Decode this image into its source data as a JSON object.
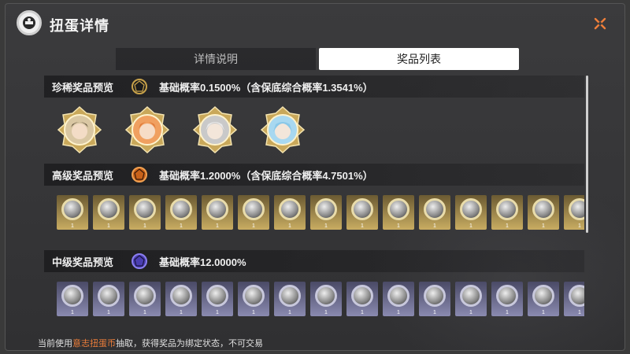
{
  "header": {
    "title": "扭蛋详情",
    "close_icon": "close-x-icon"
  },
  "tabs": [
    {
      "label": "详情说明",
      "active": false
    },
    {
      "label": "奖品列表",
      "active": true
    }
  ],
  "sections": {
    "rare": {
      "label": "珍稀奖品预览",
      "gem_icon": "black-gold-orb-icon",
      "rate": "基础概率0.1500%（含保底综合概率1.3541%）",
      "portraits": [
        {
          "hair": "#5a4a3a",
          "bg": "#d9c7a3"
        },
        {
          "hair": "#e07a3a",
          "bg": "#f0a060"
        },
        {
          "hair": "#d8d8d8",
          "bg": "#c9c9c9"
        },
        {
          "hair": "#8ac8e8",
          "bg": "#a8d8f0"
        }
      ]
    },
    "high": {
      "label": "高级奖品预览",
      "gem_icon": "orange-orb-icon",
      "rate": "基础概率1.2000%（含保底综合概率4.7501%）",
      "item_count_label": "1",
      "items": 15
    },
    "mid": {
      "label": "中级奖品预览",
      "gem_icon": "purple-orb-icon",
      "rate": "基础概率12.0000%",
      "item_count_label": "1",
      "items": 15
    }
  },
  "footer": {
    "prefix": "当前使用",
    "highlight": "意志扭蛋币",
    "suffix": "抽取，获得奖品为绑定状态，不可交易"
  },
  "colors": {
    "accent": "#f07f3a",
    "tab_active": "#ffffff"
  }
}
